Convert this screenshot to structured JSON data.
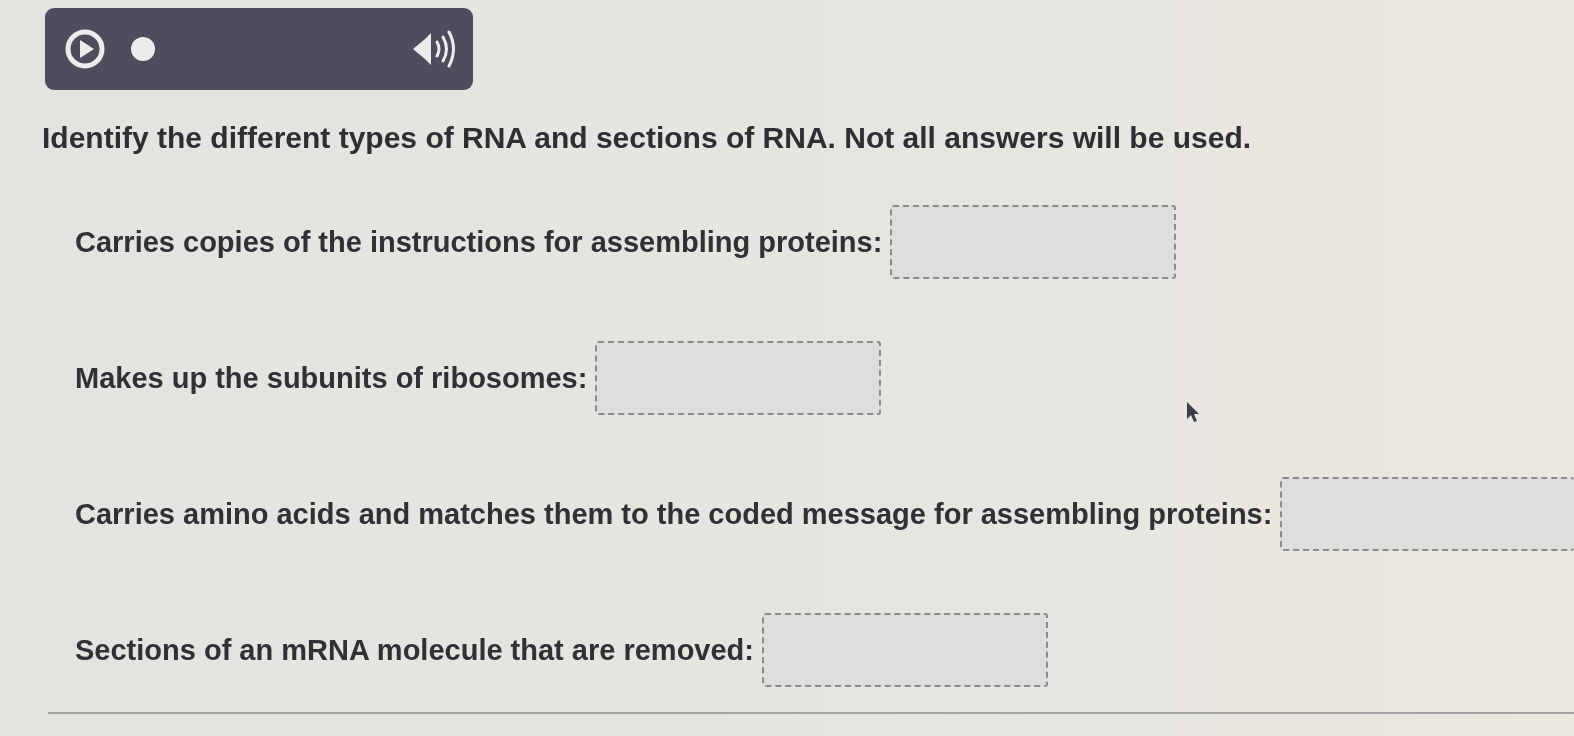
{
  "instructions": "Identify the different types of RNA and sections of RNA. Not all answers will be used.",
  "questions": [
    {
      "prompt": "Carries copies of the instructions for assembling proteins:"
    },
    {
      "prompt": "Makes up the subunits of ribosomes:"
    },
    {
      "prompt": "Carries amino acids and matches them to the coded message for assembling proteins:"
    },
    {
      "prompt": "Sections of an mRNA molecule that are removed:"
    }
  ]
}
